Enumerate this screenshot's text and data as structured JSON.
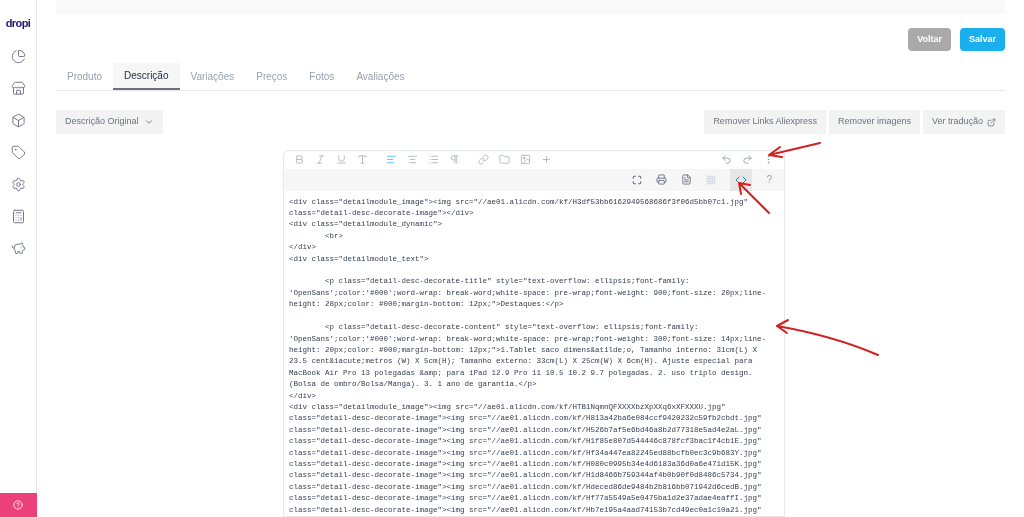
{
  "sidebar": {
    "logo": "dropi"
  },
  "actions": {
    "back": "Voltar",
    "save": "Salvar"
  },
  "tabs": [
    {
      "label": "Produto",
      "selected": false
    },
    {
      "label": "Descrição",
      "selected": true
    },
    {
      "label": "Variações",
      "selected": false
    },
    {
      "label": "Preços",
      "selected": false
    },
    {
      "label": "Fotos",
      "selected": false
    },
    {
      "label": "Avaliações",
      "selected": false
    }
  ],
  "description_select": {
    "value": "Descrição Original"
  },
  "tool_buttons": [
    "Remover Links Aliexpress",
    "Remover imagens",
    "Ver tradução"
  ],
  "editor": {
    "source_view_active": true,
    "help_label": "?",
    "blocks": [
      [
        "<div class=\"detailmodule_image\"><img src=\"//ae01.alicdn.com/kf/H3df53bb6162949568686f3f06d5bb07c1.jpg\"",
        "class=\"detail-desc-decorate-image\"></div>",
        "<div class=\"detailmodule_dynamic\">",
        "        <br>",
        "</div>",
        "<div class=\"detailmodule_text\">"
      ],
      [
        "        <p class=\"detail-desc-decorate-title\" style=\"text-overflow: ellipsis;font-family:",
        "'OpenSans';color:'#000';word-wrap: break-word;white-space: pre-wrap;font-weight: 900;font-size: 20px;line-",
        "height: 28px;color: #000;margin-bottom: 12px;\">Destaques:</p>"
      ],
      [
        "        <p class=\"detail-desc-decorate-content\" style=\"text-overflow: ellipsis;font-family:",
        "'OpenSans';color:'#000';word-wrap: break-word;white-space: pre-wrap;font-weight: 300;font-size: 14px;line-",
        "height: 20px;color: #000;margin-bottom: 12px;\">1.Tablet saco dimens&atilde;o, Tamanho interno: 31cm(L) X",
        "23.5 cent&iacute;metros (W) X 5cm(H); Tamanho externo: 33cm(L) X 25cm(W) X 6cm(H). Ajuste especial para",
        "MacBook Air Pro 13 polegadas &amp; para iPad 12.9 Pro 11 10.5 10.2 9.7 polegadas. 2. uso triplo design.",
        "(Bolsa de ombro/Bolsa/Manga). 3. 1 ano de garantia.</p>",
        "</div>",
        "<div class=\"detailmodule_image\"><img src=\"//ae01.alicdn.com/kf/HTB1NqmnQFXXXXbzXpXXq6xXFXXXU.jpg\"",
        "class=\"detail-desc-decorate-image\"><img src=\"//ae01.alicdn.com/kf/H813a42ba6e084ccf9420232c59fb2cbdt.jpg\"",
        "class=\"detail-desc-decorate-image\"><img src=\"//ae01.alicdn.com/kf/H526b7af5e6bd46a8b2d77318e5ad4e2aL.jpg\"",
        "class=\"detail-desc-decorate-image\"><img src=\"//ae01.alicdn.com/kf/H1f85e807d544446c878fcf3bac1f4cb1E.jpg\"",
        "class=\"detail-desc-decorate-image\"><img src=\"//ae01.alicdn.com/kf/Hf34a447ea82245ed88bcfb0ec3c9b683Y.jpg\"",
        "class=\"detail-desc-decorate-image\"><img src=\"//ae01.alicdn.com/kf/H080c0995b34e4d6183a36d0a6e471d15K.jpg\"",
        "class=\"detail-desc-decorate-image\"><img src=\"//ae01.alicdn.com/kf/H1d8466b759344af4b0b90f0d8486c5734.jpg\"",
        "class=\"detail-desc-decorate-image\"><img src=\"//ae01.alicdn.com/kf/Hdeced86de9484b2b816bb071942d6cedB.jpg\"",
        "class=\"detail-desc-decorate-image\"><img src=\"//ae01.alicdn.com/kf/Hf77a5549a5e0475ba1d2e37adae4eaffI.jpg\"",
        "class=\"detail-desc-decorate-image\"><img src=\"//ae01.alicdn.com/kf/Hb7e195a4aad74153b7cd49ec0a1c10a21.jpg\""
      ]
    ]
  }
}
